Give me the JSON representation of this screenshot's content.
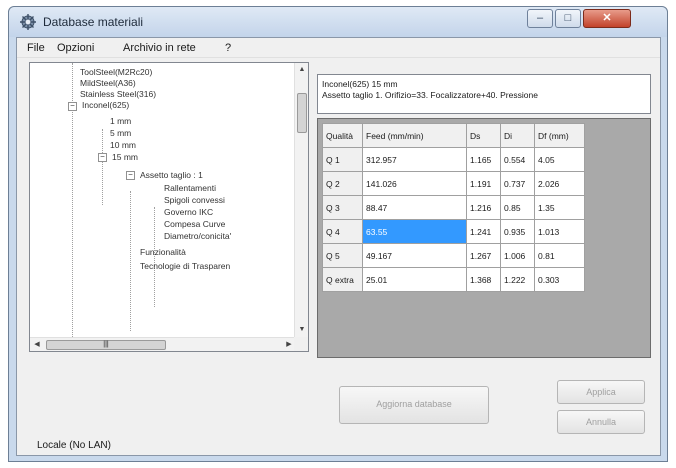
{
  "window": {
    "title": "Database materiali",
    "controls": {
      "minimize": "–",
      "maximize": "□",
      "close": "✕"
    }
  },
  "menu": {
    "file": "File",
    "opzioni": "Opzioni",
    "archivio": "Archivio in rete",
    "help": "?"
  },
  "tree": {
    "items": [
      "ToolSteel(M2Rc20)",
      "MildSteel(A36)",
      "Stainless Steel(316)",
      "Inconel(625)",
      "1 mm",
      "5 mm",
      "10 mm",
      "15 mm",
      "Assetto taglio : 1",
      "Rallentamenti",
      "Spigoli convessi",
      "Governo IKC",
      "Compesa Curve",
      "Diametro/conicita'",
      "Funzionalità",
      "Tecnologie di Trasparen"
    ],
    "hscroll_thumb": "|||"
  },
  "info": {
    "line1": "Inconel(625) 15 mm",
    "line2": "Assetto taglio 1. Orifizio=33. Focalizzatore+40. Pressione"
  },
  "grid": {
    "headers": [
      "Qualità",
      "Feed (mm/min)",
      "Ds",
      "Di",
      "Df (mm)"
    ],
    "rows": [
      [
        "Q 1",
        "312.957",
        "1.165",
        "0.554",
        "4.05"
      ],
      [
        "Q 2",
        "141.026",
        "1.191",
        "0.737",
        "2.026"
      ],
      [
        "Q 3",
        "88.47",
        "1.216",
        "0.85",
        "1.35"
      ],
      [
        "Q 4",
        "63.55",
        "1.241",
        "0.935",
        "1.013"
      ],
      [
        "Q 5",
        "49.167",
        "1.267",
        "1.006",
        "0.81"
      ],
      [
        "Q extra",
        "25.01",
        "1.368",
        "1.222",
        "0.303"
      ]
    ]
  },
  "buttons": {
    "update_db": "Aggiorna database",
    "apply": "Applica",
    "cancel": "Annulla"
  },
  "status": "Locale (No LAN)"
}
